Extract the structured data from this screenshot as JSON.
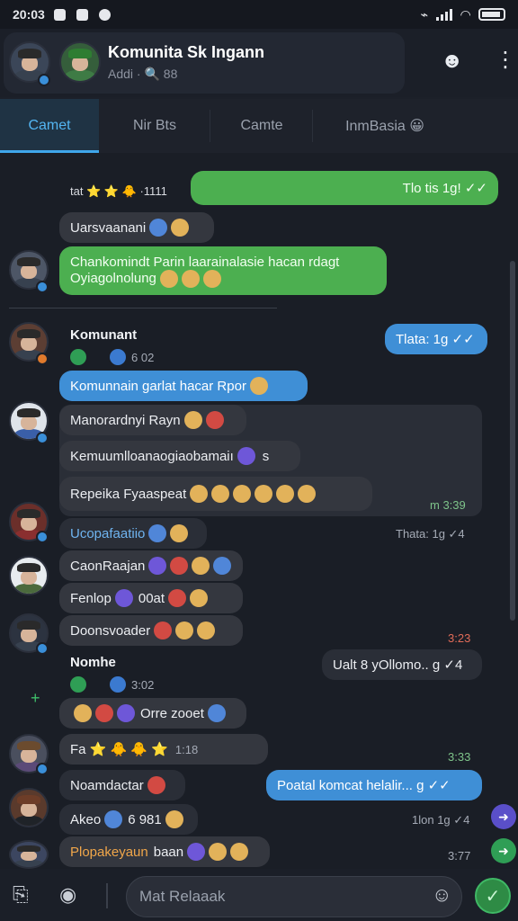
{
  "status_bar": {
    "time": "20:03",
    "icons": [
      "notification-icon",
      "square-icon",
      "profile-icon"
    ],
    "right_icons": [
      "vibrate-icon",
      "signal-icon",
      "wifi-icon",
      "battery-icon"
    ]
  },
  "header": {
    "title": "Komunita Sk Ingann",
    "subtitle": "Addi · 🔍 88",
    "actions": [
      "group-icon",
      "more-vert-icon"
    ]
  },
  "tabs": [
    {
      "label": "Camet",
      "active": true
    },
    {
      "label": "Nir Bts",
      "active": false
    },
    {
      "label": "Camte",
      "active": false
    },
    {
      "label": "InmBasia 😀",
      "active": false
    }
  ],
  "messages": {
    "m1_meta": "tat ⭐ ⭐ 🐥 ·1111",
    "m1_out": "Tlo tis 1g! ✓✓",
    "m2_text": "Uarsvaanani",
    "m3_line1": "Chankomindt Parin laarainalasie hacan rdagt",
    "m3_line2": "Oyiagolnolung",
    "m4_name": "Komunant",
    "m4_sub": "6 02",
    "m4_out": "Tlata: 1g ✓✓",
    "m5_text": "Komunnain garlat hacar Rpor",
    "m6_text": "Manorardnyi Rayn",
    "m7_text": "Kemuumlloanaogiaobamaiı",
    "m7_suffix": "s",
    "m8_text": "Repeika Fyaaspeat",
    "m8_time": "m 3:39",
    "m9_text": "Ucopafaatiio",
    "m9_meta": "Thata: 1g ✓4",
    "m10_text": "CaonRaajan",
    "m11_text": "Fenlop",
    "m11_mid": "00at",
    "m12_text": "Doonsvoader",
    "m12_time": "3:23",
    "m13_name": "Nomhe",
    "m13_sub": "3:02",
    "m13_out": "Ualt 8 yOllomo.. g ✓4",
    "m14_text": "Orre zooet",
    "m15_text": "Fa ⭐ 🐥 🐥 ⭐",
    "m15_num": "1:18",
    "m15_time": "3:33",
    "m16_text": "Noamdactar",
    "m16_out": "Poatal komcat helalir... g ✓✓",
    "m17_text": "Akeo",
    "m17_mid": "6 981",
    "m17_meta": "1lon 1g ✓4",
    "m18_text": "Plopakeyaun",
    "m18_mid": "baan",
    "m18_time": "3:77"
  },
  "composer": {
    "placeholder": "Mat Relaaak",
    "icons": [
      "attach-icon",
      "camera-icon",
      "emoji-icon",
      "send-icon"
    ]
  }
}
